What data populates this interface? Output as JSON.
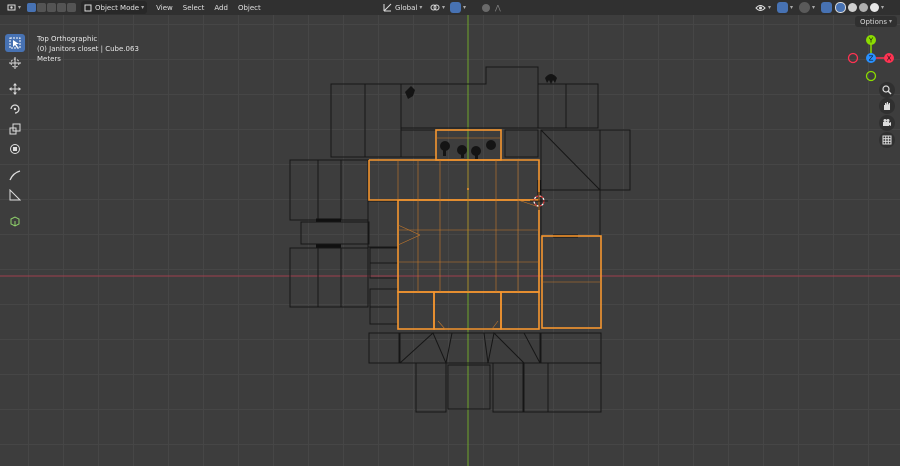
{
  "header": {
    "mode_label": "Object Mode",
    "menus": [
      "View",
      "Select",
      "Add",
      "Object"
    ],
    "transform_orientation": "Global",
    "options_label": "Options"
  },
  "viewport": {
    "view_name": "Top Orthographic",
    "object_info": "(0) Janitors closet | Cube.063",
    "units": "Meters"
  },
  "gizmo": {
    "axis_y": "Y",
    "axis_x": "X",
    "axis_z": "Z"
  },
  "colors": {
    "selection": "#f5962f",
    "x_axis": "#ff3352",
    "y_axis": "#8bdc00",
    "z_axis": "#2890ff",
    "active_tool": "#4772b3"
  },
  "icons": {
    "toolbar": [
      "select-box-icon",
      "cursor-icon",
      "move-icon",
      "rotate-icon",
      "scale-icon",
      "transform-icon",
      "annotate-icon",
      "measure-icon",
      "add-cube-icon"
    ],
    "nav": [
      "zoom-icon",
      "pan-icon",
      "camera-icon",
      "grid-icon"
    ]
  }
}
